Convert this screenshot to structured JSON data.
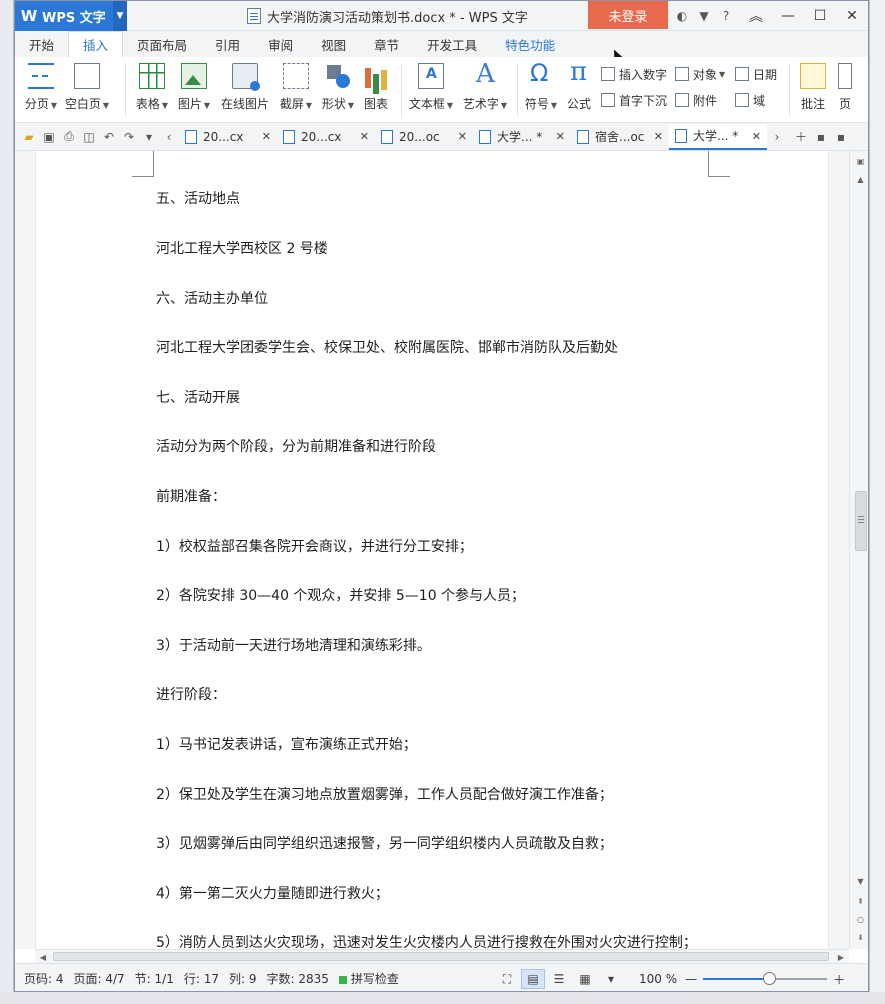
{
  "app": {
    "name": "WPS 文字",
    "window_title": "大学消防演习活动策划书.docx * - WPS 文字",
    "login_label": "未登录",
    "help_label": "?"
  },
  "menu_tabs": [
    "开始",
    "插入",
    "页面布局",
    "引用",
    "审阅",
    "视图",
    "章节",
    "开发工具",
    "特色功能"
  ],
  "active_menu_tab": "插入",
  "ribbon": {
    "page_break": "分页",
    "blank_page": "空白页",
    "table": "表格",
    "picture": "图片",
    "online_picture": "在线图片",
    "screenshot": "截屏",
    "shape": "形状",
    "chart": "图表",
    "textbox": "文本框",
    "wordart": "艺术字",
    "symbol": "符号",
    "formula": "公式",
    "insert_number": "插入数字",
    "drop_cap": "首字下沉",
    "object": "对象",
    "attachment": "附件",
    "date": "日期",
    "field": "域",
    "comment": "批注",
    "page_partial": "页"
  },
  "doc_tabs": [
    {
      "label": "20...cx",
      "active": false
    },
    {
      "label": "20...cx",
      "active": false
    },
    {
      "label": "20...oc",
      "active": false
    },
    {
      "label": "大学... *",
      "active": false
    },
    {
      "label": "宿舍...oc",
      "active": false
    },
    {
      "label": "大学... *",
      "active": true
    }
  ],
  "document": {
    "paragraphs": [
      "五、活动地点",
      "河北工程大学西校区 2 号楼",
      "六、活动主办单位",
      "河北工程大学团委学生会、校保卫处、校附属医院、邯郸市消防队及后勤处",
      "七、活动开展",
      "活动分为两个阶段，分为前期准备和进行阶段",
      "前期准备：",
      "1）校权益部召集各院开会商议，并进行分工安排；",
      "2）各院安排 30—40 个观众，并安排 5—10 个参与人员；",
      "3）于活动前一天进行场地清理和演练彩排。",
      "进行阶段：",
      "1）马书记发表讲话，宣布演练正式开始；",
      "2）保卫处及学生在演习地点放置烟雾弹，工作人员配合做好演工作准备；",
      "3）见烟雾弹后由同学组织迅速报警，另一同学组织楼内人员疏散及自救；",
      "4）第一第二灭火力量随即进行救火；",
      "5）消防人员到达火灾现场，迅速对发生火灾楼内人员进行搜救在外围对火灾进行控制；"
    ]
  },
  "status": {
    "page_no": "页码: 4",
    "pages": "页面: 4/7",
    "section": "节: 1/1",
    "line": "行: 17",
    "column": "列: 9",
    "word_count": "字数: 2835",
    "spell_check": "拼写检查",
    "zoom": "100 %"
  },
  "colors": {
    "accent": "#2b78d6",
    "login": "#e86a4e"
  }
}
